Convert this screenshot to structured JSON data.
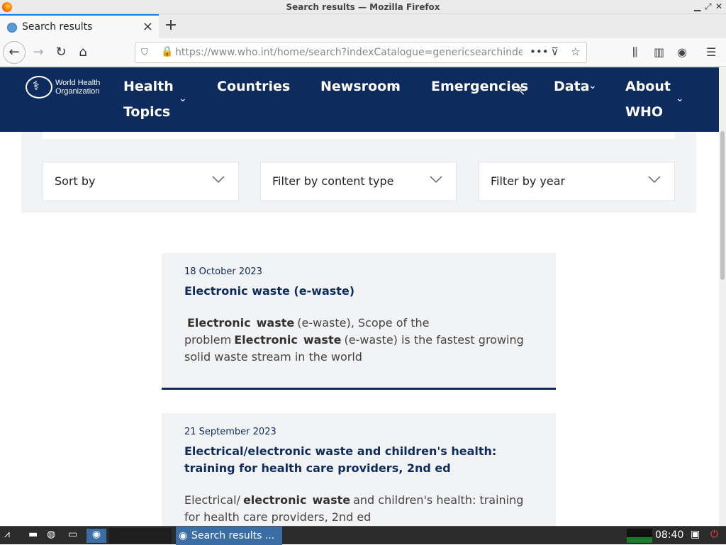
{
  "window": {
    "title": "Search results — Mozilla Firefox"
  },
  "tab": {
    "label": "Search results"
  },
  "url": {
    "text": "https://www.who.int/home/search?indexCatalogue=genericsearchinde"
  },
  "who_nav": {
    "logo_line1": "World Health",
    "logo_line2": "Organization",
    "items": [
      {
        "label_line1": "Health",
        "label_line2": "Topics"
      },
      {
        "label": "Countries"
      },
      {
        "label": "Newsroom"
      },
      {
        "label": "Emergencies"
      },
      {
        "label": "Data"
      },
      {
        "label_line1": "About",
        "label_line2": "WHO"
      }
    ]
  },
  "filters": {
    "sort": "Sort by",
    "content_type": "Filter by content type",
    "year": "Filter by year"
  },
  "results": [
    {
      "date": "18 October 2023",
      "title": "Electronic waste (e-waste)",
      "desc_parts": [
        "Electronic",
        "waste",
        "(e-waste), Scope of the problem",
        "Electronic",
        "waste",
        "(e-waste) is the fastest growing solid waste stream in the world"
      ]
    },
    {
      "date": "21 September 2023",
      "title": "Electrical/electronic waste and children's health: training for health care providers, 2nd ed",
      "desc_parts": [
        "Electrical/",
        "electronic",
        "waste",
        "and children's health: training for health care providers, 2nd ed"
      ]
    }
  ],
  "taskbar": {
    "task_label": "Search results ...",
    "clock": "08:40"
  },
  "colors": {
    "who_navy": "#0d2b5c",
    "panel_gray": "#f2f3f5",
    "tab_accent": "#0a84ff"
  }
}
